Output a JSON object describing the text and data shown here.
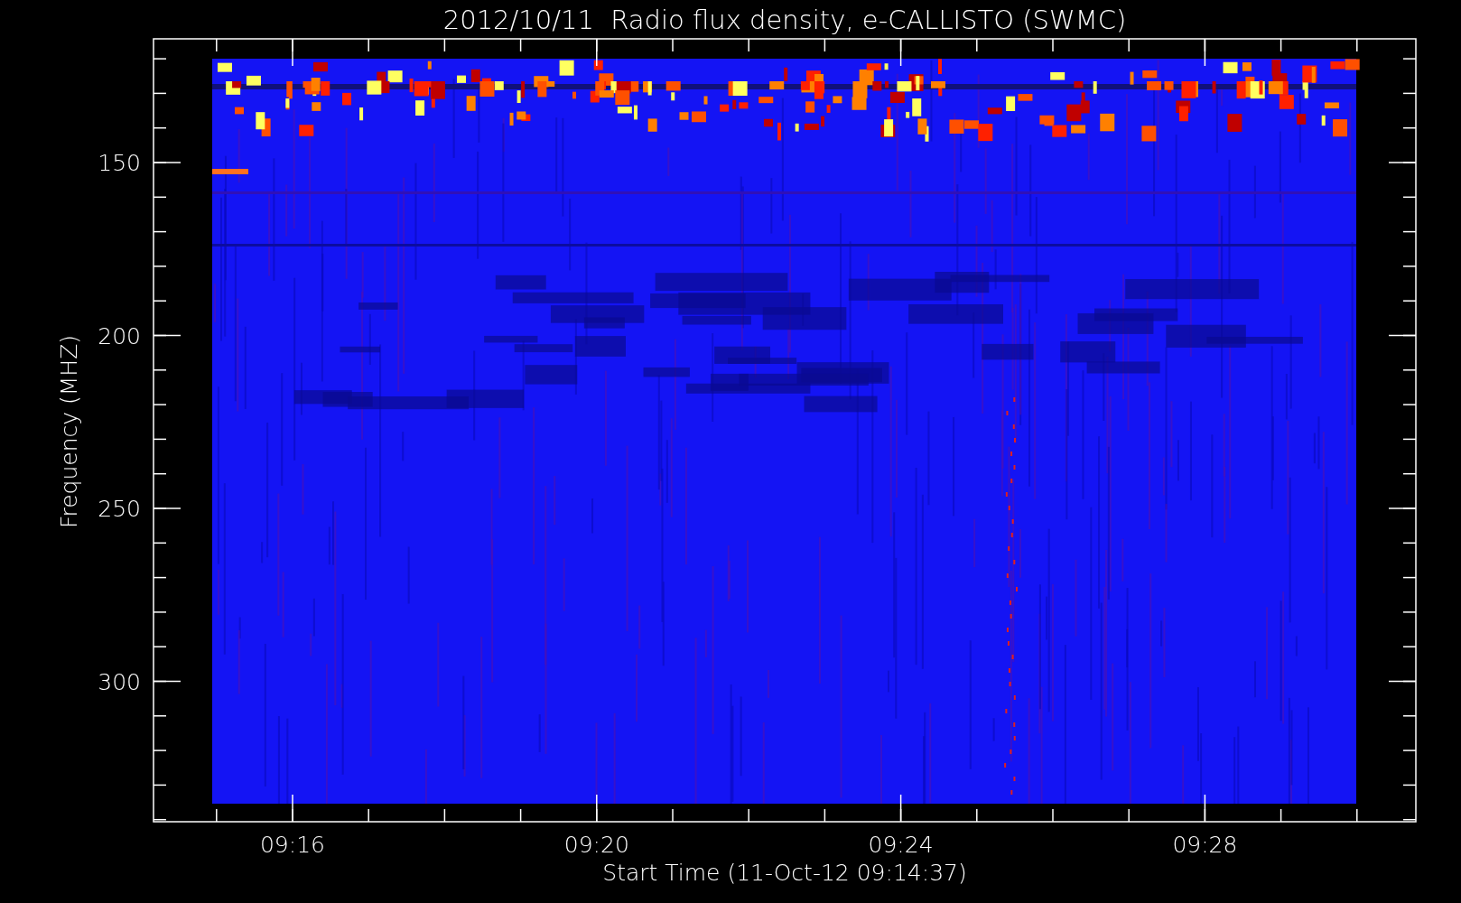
{
  "title": "2012/10/11  Radio flux density, e-CALLISTO (SWMC)",
  "y_axis": {
    "label": "Frequency (MHZ)",
    "ticks": [
      "150",
      "200",
      "250",
      "300"
    ]
  },
  "x_axis": {
    "label": "Start Time (11-Oct-12 09:14:37)",
    "ticks": [
      "09:16",
      "09:20",
      "09:24",
      "09:28"
    ]
  }
}
